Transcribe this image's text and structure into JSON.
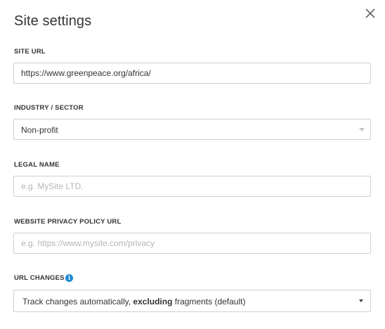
{
  "dialog": {
    "title": "Site settings",
    "close_icon": "close-icon"
  },
  "site_url": {
    "label": "SITE URL",
    "value": "https://www.greenpeace.org/africa/"
  },
  "industry": {
    "label": "INDUSTRY / SECTOR",
    "selected": "Non-profit"
  },
  "legal_name": {
    "label": "LEGAL NAME",
    "value": "",
    "placeholder": "e.g. MySite LTD."
  },
  "privacy_url": {
    "label": "WEBSITE PRIVACY POLICY URL",
    "value": "",
    "placeholder": "e.g. https://www.mysite.com/privacy"
  },
  "url_changes": {
    "label": "URL CHANGES",
    "info_icon": "info-icon",
    "selected_prefix": "Track changes automatically, ",
    "selected_bold": "excluding",
    "selected_suffix": " fragments (default)"
  },
  "colors": {
    "info_accent": "#1b8ad3",
    "border": "#d0d0d0"
  }
}
